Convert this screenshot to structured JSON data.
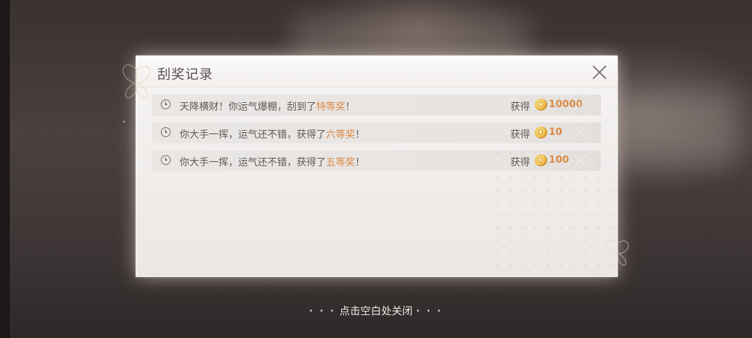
{
  "dialog": {
    "title": "刮奖记录",
    "close_icon": "close-icon"
  },
  "records": [
    {
      "prefix": "天降横财！你运气爆棚，刮到了",
      "prize": "特等奖",
      "suffix": "！",
      "obtain_label": "获得",
      "amount": "10000"
    },
    {
      "prefix": "你大手一挥，运气还不错，获得了",
      "prize": "六等奖",
      "suffix": "！",
      "obtain_label": "获得",
      "amount": "10"
    },
    {
      "prefix": "你大手一挥，运气还不错，获得了",
      "prize": "五等奖",
      "suffix": "！",
      "obtain_label": "获得",
      "amount": "100"
    }
  ],
  "footer": {
    "hint": "点击空白处关闭"
  },
  "colors": {
    "prize_accent": "#d98a45",
    "text": "#5f5958"
  }
}
